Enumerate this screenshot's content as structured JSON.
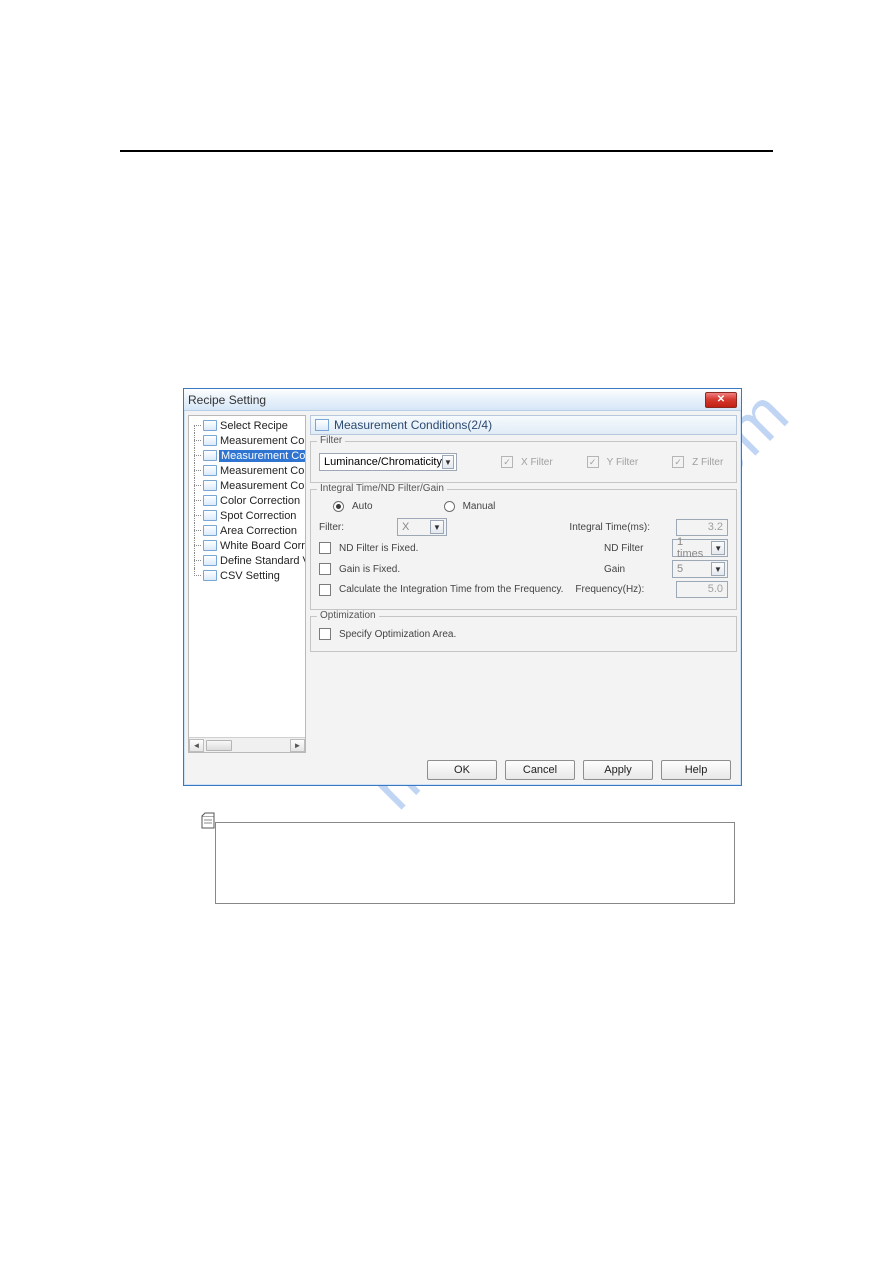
{
  "watermark": "manualshive.com",
  "dialog": {
    "title": "Recipe Setting",
    "tree": [
      "Select Recipe",
      "Measurement Co",
      "Measurement Co",
      "Measurement Co",
      "Measurement Co",
      "Color Correction",
      "Spot Correction",
      "Area Correction",
      "White Board Corr",
      "Define Standard V",
      "CSV Setting"
    ],
    "tree_selected_index": 2,
    "section_header": "Measurement Conditions(2/4)",
    "filter_group": {
      "legend": "Filter",
      "combo_value": "Luminance/Chromaticity",
      "x_filter_label": "X Filter",
      "y_filter_label": "Y Filter",
      "z_filter_label": "Z Filter",
      "x_checked": true,
      "y_checked": true,
      "z_checked": true
    },
    "integral_group": {
      "legend": "Integral Time/ND Filter/Gain",
      "auto_label": "Auto",
      "manual_label": "Manual",
      "mode": "auto",
      "filter_label": "Filter:",
      "filter_value": "X",
      "integral_time_label": "Integral Time(ms):",
      "integral_time_value": "3.2",
      "nd_fixed_label": "ND Filter is Fixed.",
      "nd_filter_label": "ND Filter",
      "nd_filter_value": "1 times",
      "gain_fixed_label": "Gain is Fixed.",
      "gain_label": "Gain",
      "gain_value": "5",
      "calc_freq_label": "Calculate the Integration Time from the Frequency.",
      "freq_label": "Frequency(Hz):",
      "freq_value": "5.0"
    },
    "opt_group": {
      "legend": "Optimization",
      "specify_label": "Specify Optimization Area."
    },
    "buttons": {
      "ok": "OK",
      "cancel": "Cancel",
      "apply": "Apply",
      "help": "Help"
    }
  }
}
